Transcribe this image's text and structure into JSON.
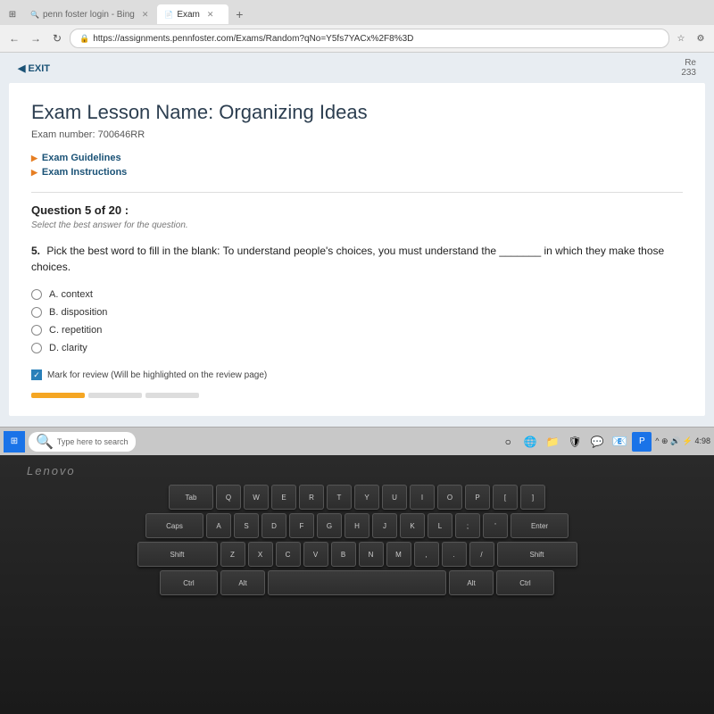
{
  "browser": {
    "tabs": [
      {
        "label": "penn foster login - Bing",
        "active": false,
        "favicon": "🔍"
      },
      {
        "label": "Exam",
        "active": true,
        "favicon": "📄"
      }
    ],
    "url": "https://assignments.pennfoster.com/Exams/Random?qNo=Y5fs7YACx%2F8%3D",
    "new_tab_label": "+",
    "nav": {
      "back": "←",
      "forward": "→",
      "refresh": "↻"
    }
  },
  "page": {
    "exit_label": "◀ EXIT",
    "header_right_line1": "Re",
    "header_right_line2": "233"
  },
  "exam": {
    "title": "Exam Lesson Name: Organizing Ideas",
    "exam_number_label": "Exam number: 700646RR",
    "guidelines_label": "Exam Guidelines",
    "instructions_label": "Exam Instructions",
    "question_header": "Question 5 of 20 :",
    "question_instruction": "Select the best answer for the question.",
    "question_number": "5.",
    "question_text": "Pick the best word to fill in the blank: To understand people's choices, you must understand the _______ in which they make those choices.",
    "options": [
      {
        "id": "A",
        "label": "A. context"
      },
      {
        "id": "B",
        "label": "B. disposition"
      },
      {
        "id": "C",
        "label": "C. repetition"
      },
      {
        "id": "D",
        "label": "D. clarity"
      }
    ],
    "mark_review_label": "Mark for review (Will be highlighted on the review page)"
  },
  "taskbar": {
    "search_placeholder": "Type here to search",
    "start_icon": "⊞",
    "search_icon": "🔍",
    "taskbar_app_icons": [
      "🌐",
      "📁",
      "🛡",
      "💬",
      "📧"
    ],
    "systray": "^ ⊕ 🔊 ⚡ 4:98"
  },
  "keyboard": {
    "brand": "Lenovo",
    "rows": [
      [
        "Tab",
        "Q",
        "W",
        "E",
        "R",
        "T",
        "Y",
        "U",
        "I",
        "O",
        "P",
        "[",
        "]"
      ],
      [
        "CapsLk",
        "A",
        "S",
        "D",
        "F",
        "G",
        "H",
        "J",
        "K",
        "L",
        ";",
        "'",
        "Enter"
      ],
      [
        "Shift",
        "Z",
        "X",
        "C",
        "V",
        "B",
        "N",
        "M",
        ",",
        ".",
        "/",
        "Shift"
      ],
      [
        "Ctrl",
        "Alt",
        "",
        "Alt",
        "Ctrl"
      ]
    ]
  }
}
